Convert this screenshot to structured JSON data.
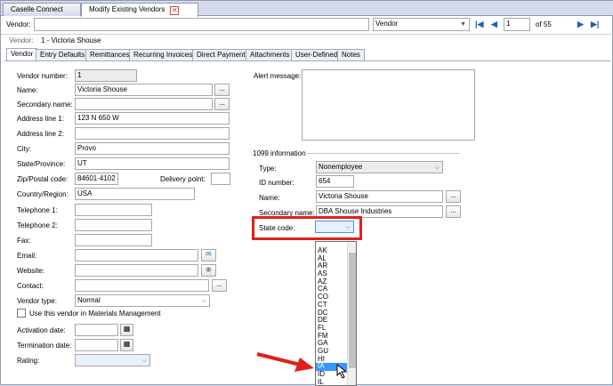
{
  "tabs": {
    "caselle": "Caselle Connect",
    "modify": "Modify Existing Vendors"
  },
  "toolbar": {
    "vendor_label": "Vendor:",
    "vendor_value": "",
    "search_by": "Vendor",
    "page_current": "1",
    "page_total": "of 55"
  },
  "header": {
    "vendor_label": "Vendor:",
    "vendor_value": "1 - Victoria Shouse"
  },
  "subtabs": [
    "Vendor",
    "Entry Defaults",
    "Remittances",
    "Recurring Invoices",
    "Direct Payment",
    "Attachments",
    "User-Defined",
    "Notes"
  ],
  "form": {
    "vendor_number_label": "Vendor number:",
    "vendor_number": "1",
    "name_label": "Name:",
    "name": "Victoria Shouse",
    "secondary_name_label": "Secondary name:",
    "secondary_name": "",
    "address1_label": "Address line 1:",
    "address1": "123 N 650 W",
    "address2_label": "Address line 2:",
    "address2": "",
    "city_label": "City:",
    "city": "Provo",
    "state_label": "State/Province:",
    "state": "UT",
    "zip_label": "Zip/Postal code:",
    "zip": "84601-4102",
    "delivery_label": "Delivery point:",
    "delivery": "",
    "country_label": "Country/Region:",
    "country": "USA",
    "tel1_label": "Telephone 1:",
    "tel2_label": "Telephone 2:",
    "fax_label": "Fax:",
    "email_label": "Email:",
    "website_label": "Website:",
    "contact_label": "Contact:",
    "vendor_type_label": "Vendor type:",
    "vendor_type": "Normal",
    "materials_label": "Use this vendor in Materials Management",
    "activation_label": "Activation date:",
    "termination_label": "Termination date:",
    "rating_label": "Rating:",
    "alert_label": "Alert message:"
  },
  "info1099": {
    "title": "1099 information",
    "type_label": "Type:",
    "type": "Nonemployee",
    "id_label": "ID number:",
    "id": "654",
    "name_label": "Name:",
    "name": "Victoria Shouse",
    "secondary_label": "Secondary name:",
    "secondary": "DBA Shouse Industries",
    "state_code_label": "State code:"
  },
  "state_codes": [
    "AK",
    "AL",
    "AR",
    "AS",
    "AZ",
    "CA",
    "CO",
    "CT",
    "DC",
    "DE",
    "FL",
    "FM",
    "GA",
    "GU",
    "HI",
    "IA",
    "ID",
    "IL"
  ],
  "selected_state_code_index": 15,
  "colors": {
    "highlight_box": "#e0201b",
    "arrow": "#e0201b",
    "selection": "#3399ff"
  }
}
